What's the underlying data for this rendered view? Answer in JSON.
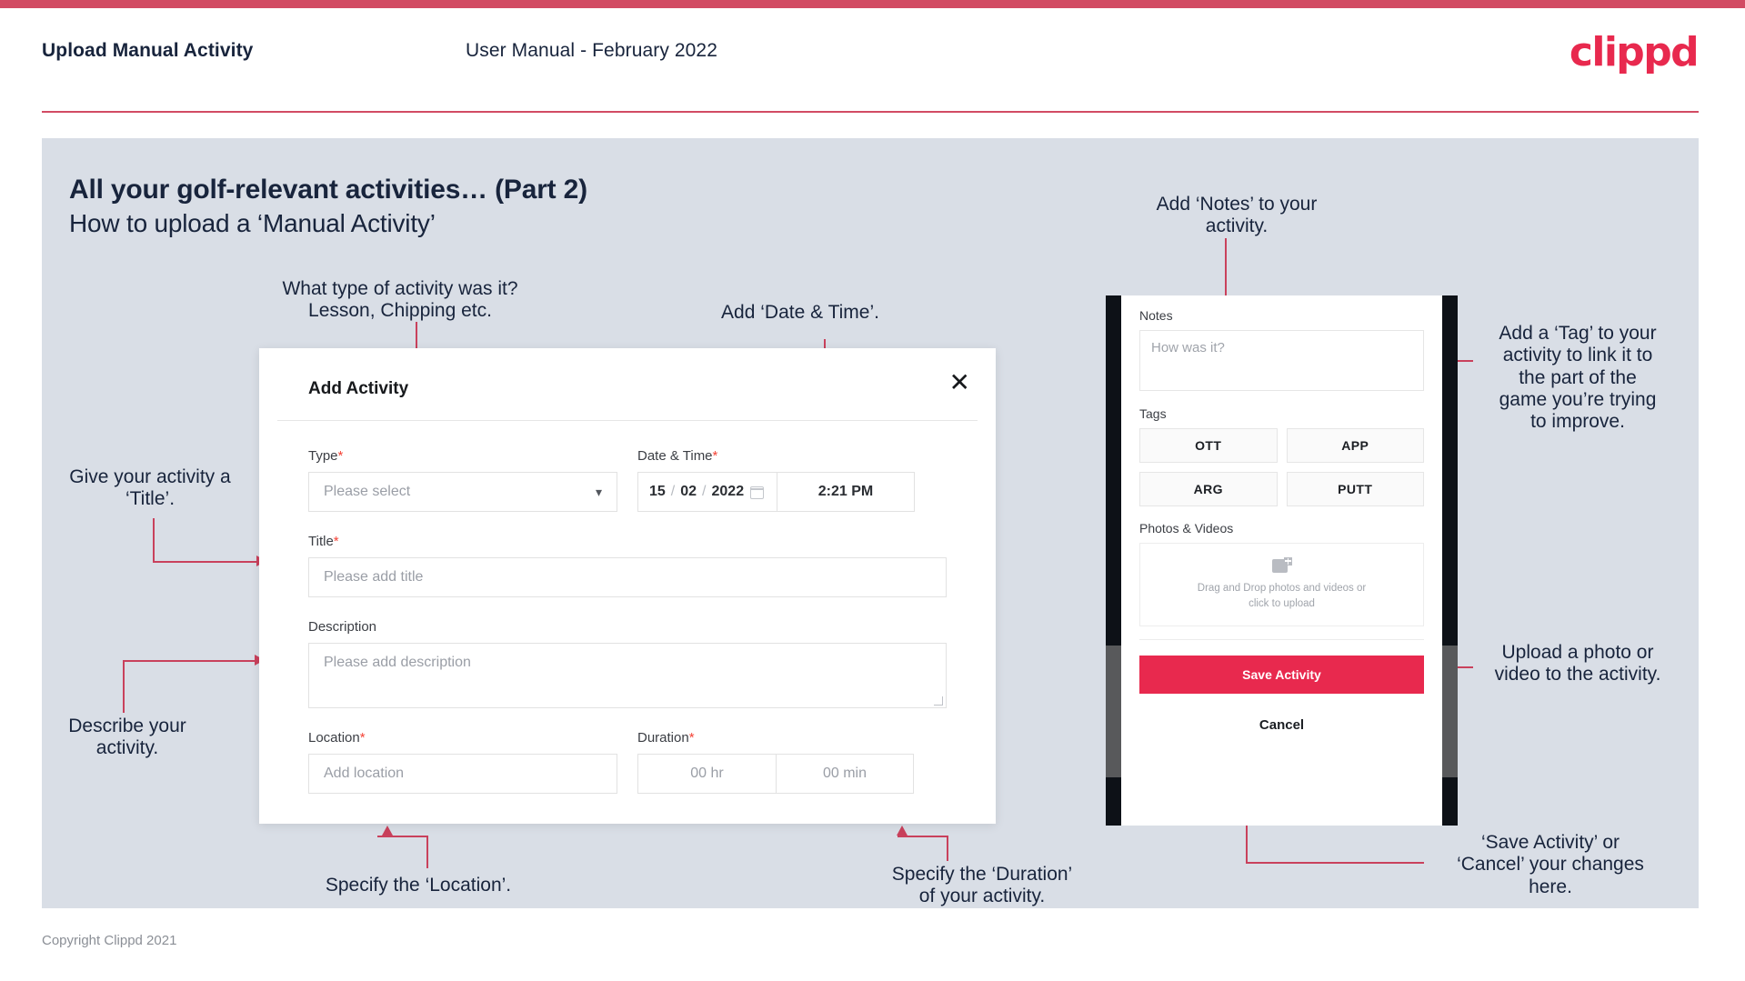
{
  "header": {
    "title": "Upload Manual Activity",
    "subtitle": "User Manual - February 2022",
    "logo": "clippd"
  },
  "slide": {
    "title": "All your golf-relevant activities… (Part 2)",
    "subtitle": "How to upload a ‘Manual Activity’"
  },
  "callouts": {
    "type": "What type of activity was it?\nLesson, Chipping etc.",
    "datetime": "Add ‘Date & Time’.",
    "title": "Give your activity a\n‘Title’.",
    "description": "Describe your\nactivity.",
    "location": "Specify the ‘Location’.",
    "duration": "Specify the ‘Duration’\nof your activity.",
    "notes": "Add ‘Notes’ to your\nactivity.",
    "tags": "Add a ‘Tag’ to your\nactivity to link it to\nthe part of the\ngame you’re trying\nto improve.",
    "photos": "Upload a photo or\nvideo to the activity.",
    "save": "‘Save Activity’ or\n‘Cancel’ your changes\nhere."
  },
  "dialog": {
    "title": "Add Activity",
    "close_icon": "close-icon",
    "fields": {
      "type": {
        "label": "Type",
        "required": "*",
        "placeholder": "Please select",
        "chevron_icon": "chevron-down-icon"
      },
      "datetime": {
        "label": "Date & Time",
        "required": "*",
        "day": "15",
        "sep1": "/",
        "month": "02",
        "sep2": "/",
        "year": "2022",
        "calendar_icon": "calendar-icon",
        "time": "2:21 PM"
      },
      "title": {
        "label": "Title",
        "required": "*",
        "placeholder": "Please add title"
      },
      "description": {
        "label": "Description",
        "placeholder": "Please add description"
      },
      "location": {
        "label": "Location",
        "required": "*",
        "placeholder": "Add location"
      },
      "duration": {
        "label": "Duration",
        "required": "*",
        "hours": "00 hr",
        "minutes": "00 min"
      }
    }
  },
  "phone": {
    "notes": {
      "label": "Notes",
      "placeholder": "How was it?"
    },
    "tags": {
      "label": "Tags",
      "items": [
        "OTT",
        "APP",
        "ARG",
        "PUTT"
      ]
    },
    "photos": {
      "label": "Photos & Videos",
      "icon": "add-image-icon",
      "text": "Drag and Drop photos and videos or click to upload"
    },
    "save_label": "Save Activity",
    "cancel_label": "Cancel"
  },
  "footer": {
    "copyright": "Copyright Clippd 2021"
  },
  "colors": {
    "brand_pink": "#e8294e",
    "rule_red": "#d24b63",
    "connector": "#c9415c",
    "slide_bg": "#d9dee6",
    "text_dark": "#18243c"
  }
}
